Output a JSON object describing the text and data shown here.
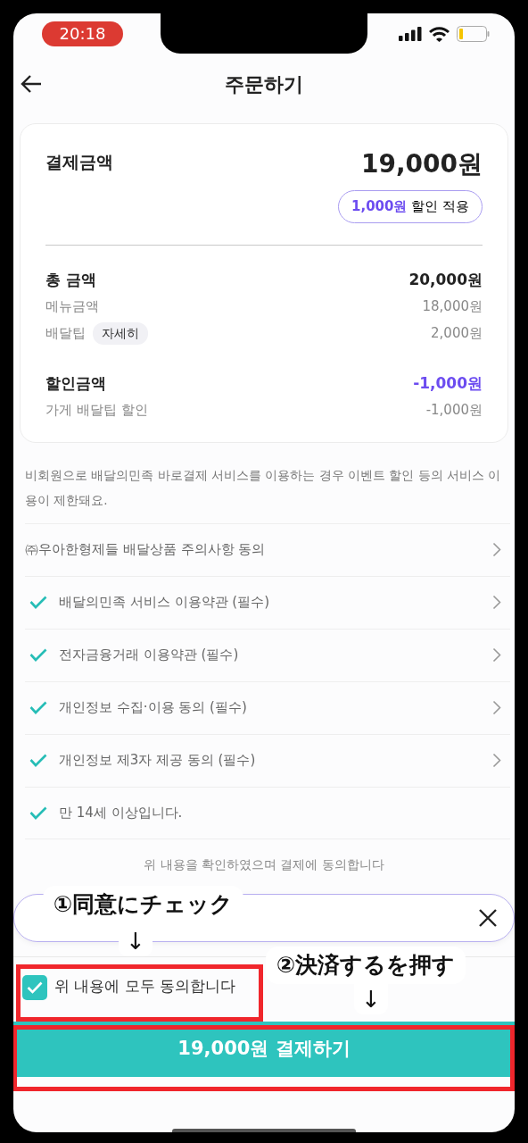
{
  "status_bar": {
    "time": "20:18"
  },
  "header": {
    "title": "주문하기"
  },
  "summary": {
    "label": "결제금액",
    "amount": "19,000원",
    "discount_chip": {
      "amount": "1,000원",
      "text": "할인 적용"
    }
  },
  "rows": [
    {
      "kind": "total",
      "label": "총 금액",
      "value": "20,000원"
    },
    {
      "kind": "sub",
      "label": "메뉴금액",
      "value": "18,000원"
    },
    {
      "kind": "sub",
      "label": "배달팁",
      "value": "2,000원",
      "detail_button": "자세히"
    },
    {
      "kind": "discount",
      "label": "할인금액",
      "value": "-1,000원"
    },
    {
      "kind": "sub",
      "label": "가게 배달팁 할인",
      "value": "-1,000원"
    }
  ],
  "notice": "비회원으로 배달의민족 바로결제 서비스를 이용하는 경우 이벤트 할인 등의 서비스 이용이 제한돼요.",
  "terms": [
    {
      "label": "㈜우아한형제들 배달상품 주의사항 동의",
      "checked": false,
      "linked": true
    },
    {
      "label": "배달의민족 서비스 이용약관 (필수)",
      "checked": true,
      "linked": true
    },
    {
      "label": "전자금융거래 이용약관 (필수)",
      "checked": true,
      "linked": true
    },
    {
      "label": "개인정보 수집·이용 동의 (필수)",
      "checked": true,
      "linked": true
    },
    {
      "label": "개인정보 제3자 제공 동의 (필수)",
      "checked": true,
      "linked": true
    },
    {
      "label": "만 14세 이상입니다.",
      "checked": true,
      "linked": false
    }
  ],
  "agreement_note": "위 내용을 확인하였으며 결제에 동의합니다",
  "agree_all": {
    "label": "위 내용에 모두 동의합니다",
    "checked": true
  },
  "pay_button": {
    "label": "19,000원 결제하기"
  },
  "annotations": [
    {
      "text": "①同意にチェック",
      "arrow": "↓"
    },
    {
      "text": "②決済するを押す",
      "arrow": "↓"
    }
  ]
}
